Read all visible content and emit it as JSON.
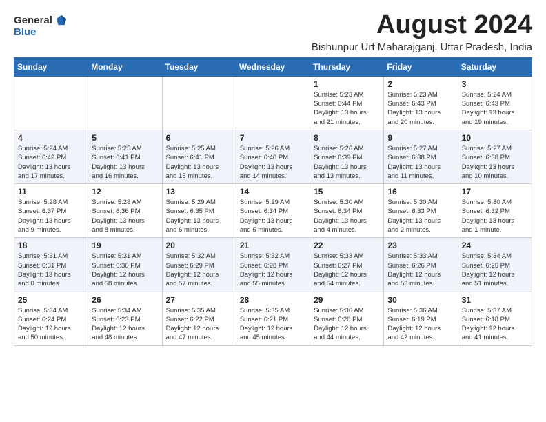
{
  "header": {
    "logo_general": "General",
    "logo_blue": "Blue",
    "month_title": "August 2024",
    "location": "Bishunpur Urf Maharajganj, Uttar Pradesh, India"
  },
  "calendar": {
    "days_of_week": [
      "Sunday",
      "Monday",
      "Tuesday",
      "Wednesday",
      "Thursday",
      "Friday",
      "Saturday"
    ],
    "weeks": [
      [
        {
          "day": "",
          "info": ""
        },
        {
          "day": "",
          "info": ""
        },
        {
          "day": "",
          "info": ""
        },
        {
          "day": "",
          "info": ""
        },
        {
          "day": "1",
          "info": "Sunrise: 5:23 AM\nSunset: 6:44 PM\nDaylight: 13 hours\nand 21 minutes."
        },
        {
          "day": "2",
          "info": "Sunrise: 5:23 AM\nSunset: 6:43 PM\nDaylight: 13 hours\nand 20 minutes."
        },
        {
          "day": "3",
          "info": "Sunrise: 5:24 AM\nSunset: 6:43 PM\nDaylight: 13 hours\nand 19 minutes."
        }
      ],
      [
        {
          "day": "4",
          "info": "Sunrise: 5:24 AM\nSunset: 6:42 PM\nDaylight: 13 hours\nand 17 minutes."
        },
        {
          "day": "5",
          "info": "Sunrise: 5:25 AM\nSunset: 6:41 PM\nDaylight: 13 hours\nand 16 minutes."
        },
        {
          "day": "6",
          "info": "Sunrise: 5:25 AM\nSunset: 6:41 PM\nDaylight: 13 hours\nand 15 minutes."
        },
        {
          "day": "7",
          "info": "Sunrise: 5:26 AM\nSunset: 6:40 PM\nDaylight: 13 hours\nand 14 minutes."
        },
        {
          "day": "8",
          "info": "Sunrise: 5:26 AM\nSunset: 6:39 PM\nDaylight: 13 hours\nand 13 minutes."
        },
        {
          "day": "9",
          "info": "Sunrise: 5:27 AM\nSunset: 6:38 PM\nDaylight: 13 hours\nand 11 minutes."
        },
        {
          "day": "10",
          "info": "Sunrise: 5:27 AM\nSunset: 6:38 PM\nDaylight: 13 hours\nand 10 minutes."
        }
      ],
      [
        {
          "day": "11",
          "info": "Sunrise: 5:28 AM\nSunset: 6:37 PM\nDaylight: 13 hours\nand 9 minutes."
        },
        {
          "day": "12",
          "info": "Sunrise: 5:28 AM\nSunset: 6:36 PM\nDaylight: 13 hours\nand 8 minutes."
        },
        {
          "day": "13",
          "info": "Sunrise: 5:29 AM\nSunset: 6:35 PM\nDaylight: 13 hours\nand 6 minutes."
        },
        {
          "day": "14",
          "info": "Sunrise: 5:29 AM\nSunset: 6:34 PM\nDaylight: 13 hours\nand 5 minutes."
        },
        {
          "day": "15",
          "info": "Sunrise: 5:30 AM\nSunset: 6:34 PM\nDaylight: 13 hours\nand 4 minutes."
        },
        {
          "day": "16",
          "info": "Sunrise: 5:30 AM\nSunset: 6:33 PM\nDaylight: 13 hours\nand 2 minutes."
        },
        {
          "day": "17",
          "info": "Sunrise: 5:30 AM\nSunset: 6:32 PM\nDaylight: 13 hours\nand 1 minute."
        }
      ],
      [
        {
          "day": "18",
          "info": "Sunrise: 5:31 AM\nSunset: 6:31 PM\nDaylight: 13 hours\nand 0 minutes."
        },
        {
          "day": "19",
          "info": "Sunrise: 5:31 AM\nSunset: 6:30 PM\nDaylight: 12 hours\nand 58 minutes."
        },
        {
          "day": "20",
          "info": "Sunrise: 5:32 AM\nSunset: 6:29 PM\nDaylight: 12 hours\nand 57 minutes."
        },
        {
          "day": "21",
          "info": "Sunrise: 5:32 AM\nSunset: 6:28 PM\nDaylight: 12 hours\nand 55 minutes."
        },
        {
          "day": "22",
          "info": "Sunrise: 5:33 AM\nSunset: 6:27 PM\nDaylight: 12 hours\nand 54 minutes."
        },
        {
          "day": "23",
          "info": "Sunrise: 5:33 AM\nSunset: 6:26 PM\nDaylight: 12 hours\nand 53 minutes."
        },
        {
          "day": "24",
          "info": "Sunrise: 5:34 AM\nSunset: 6:25 PM\nDaylight: 12 hours\nand 51 minutes."
        }
      ],
      [
        {
          "day": "25",
          "info": "Sunrise: 5:34 AM\nSunset: 6:24 PM\nDaylight: 12 hours\nand 50 minutes."
        },
        {
          "day": "26",
          "info": "Sunrise: 5:34 AM\nSunset: 6:23 PM\nDaylight: 12 hours\nand 48 minutes."
        },
        {
          "day": "27",
          "info": "Sunrise: 5:35 AM\nSunset: 6:22 PM\nDaylight: 12 hours\nand 47 minutes."
        },
        {
          "day": "28",
          "info": "Sunrise: 5:35 AM\nSunset: 6:21 PM\nDaylight: 12 hours\nand 45 minutes."
        },
        {
          "day": "29",
          "info": "Sunrise: 5:36 AM\nSunset: 6:20 PM\nDaylight: 12 hours\nand 44 minutes."
        },
        {
          "day": "30",
          "info": "Sunrise: 5:36 AM\nSunset: 6:19 PM\nDaylight: 12 hours\nand 42 minutes."
        },
        {
          "day": "31",
          "info": "Sunrise: 5:37 AM\nSunset: 6:18 PM\nDaylight: 12 hours\nand 41 minutes."
        }
      ]
    ]
  }
}
